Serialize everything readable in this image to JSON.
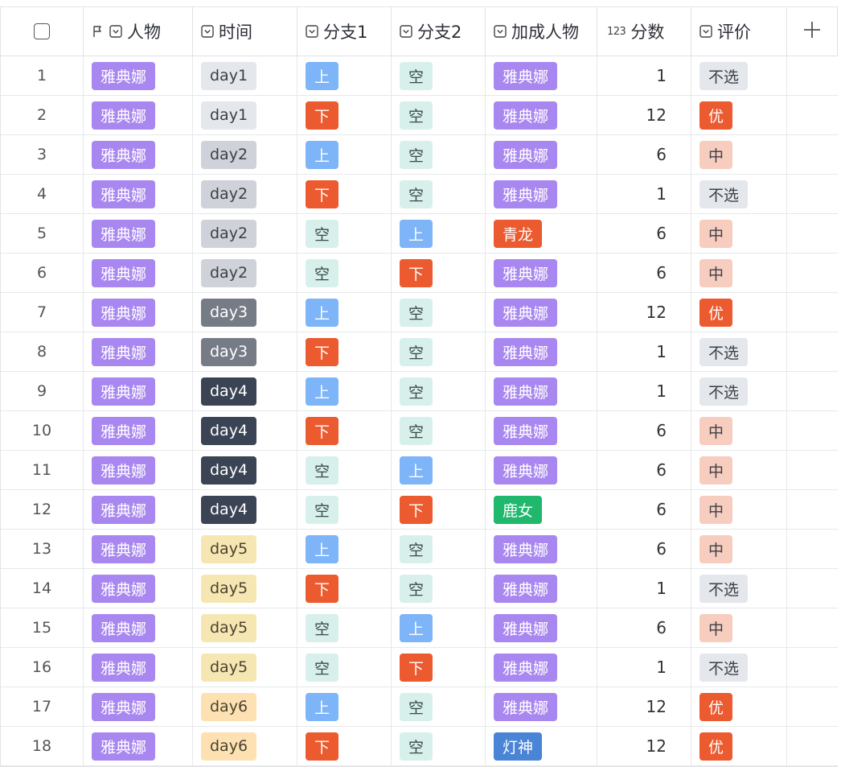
{
  "columns": {
    "person": "人物",
    "time": "时间",
    "branch1": "分支1",
    "branch2": "分支2",
    "bonus_person": "加成人物",
    "score": "分数",
    "score_type_icon": "123",
    "rating": "评价"
  },
  "icons": {
    "select_all": "checkbox-icon",
    "primary_field": "flag-icon",
    "single_select": "select-field-icon",
    "number_field": "number-icon",
    "add_column": "plus-icon"
  },
  "colors": {
    "purple": "#a987f0",
    "blue_light": "#7eb4f8",
    "red": "#ec5a2f",
    "mint": "#d8f0eb",
    "teal_green": "#1fb86c",
    "steel_blue": "#4a84d6",
    "day1": "#e4e7ec",
    "day2": "#cfd2d8",
    "day3": "#767c86",
    "day4": "#3a4454",
    "day5": "#f6e7b2",
    "day6": "#fde1b2",
    "rating_none": "#e4e7ec",
    "rating_mid": "#f7cdc0",
    "rating_good": "#ec5a2f"
  },
  "rows": [
    {
      "id": "1",
      "person": "雅典娜",
      "time": "day1",
      "branch1": "上",
      "branch2": "空",
      "bonus_person": "雅典娜",
      "score": "1",
      "rating": "不选"
    },
    {
      "id": "2",
      "person": "雅典娜",
      "time": "day1",
      "branch1": "下",
      "branch2": "空",
      "bonus_person": "雅典娜",
      "score": "12",
      "rating": "优"
    },
    {
      "id": "3",
      "person": "雅典娜",
      "time": "day2",
      "branch1": "上",
      "branch2": "空",
      "bonus_person": "雅典娜",
      "score": "6",
      "rating": "中"
    },
    {
      "id": "4",
      "person": "雅典娜",
      "time": "day2",
      "branch1": "下",
      "branch2": "空",
      "bonus_person": "雅典娜",
      "score": "1",
      "rating": "不选"
    },
    {
      "id": "5",
      "person": "雅典娜",
      "time": "day2",
      "branch1": "空",
      "branch2": "上",
      "bonus_person": "青龙",
      "score": "6",
      "rating": "中"
    },
    {
      "id": "6",
      "person": "雅典娜",
      "time": "day2",
      "branch1": "空",
      "branch2": "下",
      "bonus_person": "雅典娜",
      "score": "6",
      "rating": "中"
    },
    {
      "id": "7",
      "person": "雅典娜",
      "time": "day3",
      "branch1": "上",
      "branch2": "空",
      "bonus_person": "雅典娜",
      "score": "12",
      "rating": "优"
    },
    {
      "id": "8",
      "person": "雅典娜",
      "time": "day3",
      "branch1": "下",
      "branch2": "空",
      "bonus_person": "雅典娜",
      "score": "1",
      "rating": "不选"
    },
    {
      "id": "9",
      "person": "雅典娜",
      "time": "day4",
      "branch1": "上",
      "branch2": "空",
      "bonus_person": "雅典娜",
      "score": "1",
      "rating": "不选"
    },
    {
      "id": "10",
      "person": "雅典娜",
      "time": "day4",
      "branch1": "下",
      "branch2": "空",
      "bonus_person": "雅典娜",
      "score": "6",
      "rating": "中"
    },
    {
      "id": "11",
      "person": "雅典娜",
      "time": "day4",
      "branch1": "空",
      "branch2": "上",
      "bonus_person": "雅典娜",
      "score": "6",
      "rating": "中"
    },
    {
      "id": "12",
      "person": "雅典娜",
      "time": "day4",
      "branch1": "空",
      "branch2": "下",
      "bonus_person": "鹿女",
      "score": "6",
      "rating": "中"
    },
    {
      "id": "13",
      "person": "雅典娜",
      "time": "day5",
      "branch1": "上",
      "branch2": "空",
      "bonus_person": "雅典娜",
      "score": "6",
      "rating": "中"
    },
    {
      "id": "14",
      "person": "雅典娜",
      "time": "day5",
      "branch1": "下",
      "branch2": "空",
      "bonus_person": "雅典娜",
      "score": "1",
      "rating": "不选"
    },
    {
      "id": "15",
      "person": "雅典娜",
      "time": "day5",
      "branch1": "空",
      "branch2": "上",
      "bonus_person": "雅典娜",
      "score": "6",
      "rating": "中"
    },
    {
      "id": "16",
      "person": "雅典娜",
      "time": "day5",
      "branch1": "空",
      "branch2": "下",
      "bonus_person": "雅典娜",
      "score": "1",
      "rating": "不选"
    },
    {
      "id": "17",
      "person": "雅典娜",
      "time": "day6",
      "branch1": "上",
      "branch2": "空",
      "bonus_person": "雅典娜",
      "score": "12",
      "rating": "优"
    },
    {
      "id": "18",
      "person": "雅典娜",
      "time": "day6",
      "branch1": "下",
      "branch2": "空",
      "bonus_person": "灯神",
      "score": "12",
      "rating": "优"
    }
  ]
}
